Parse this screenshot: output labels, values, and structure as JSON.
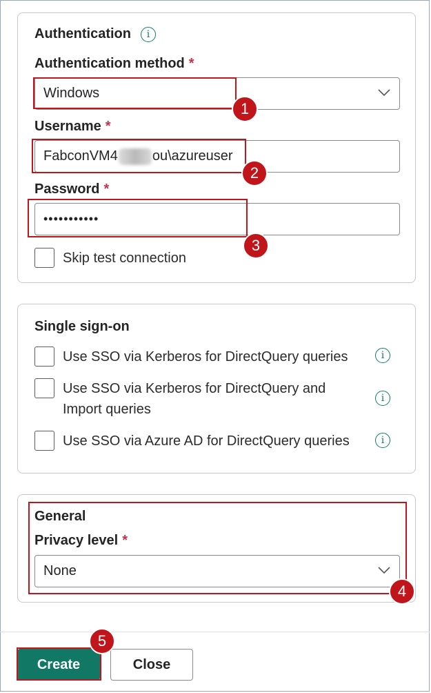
{
  "authentication": {
    "title": "Authentication",
    "method_label": "Authentication method",
    "method_value": "Windows",
    "username_label": "Username",
    "username_prefix": "FabconVM4",
    "username_suffix": "ou\\azureuser",
    "password_label": "Password",
    "password_value": "•••••••••••",
    "skip_test_label": "Skip test connection",
    "required_mark": "*"
  },
  "sso": {
    "title": "Single sign-on",
    "options": [
      {
        "label": "Use SSO via Kerberos for DirectQuery queries"
      },
      {
        "label": "Use SSO via Kerberos for DirectQuery and Import queries"
      },
      {
        "label": "Use SSO via Azure AD for DirectQuery queries"
      }
    ]
  },
  "general": {
    "title": "General",
    "privacy_label": "Privacy level",
    "privacy_value": "None"
  },
  "buttons": {
    "create": "Create",
    "close": "Close"
  },
  "callouts": [
    "1",
    "2",
    "3",
    "4",
    "5"
  ],
  "colors": {
    "accent": "#117865",
    "callout": "#c0151b",
    "required": "#c4314b",
    "info_icon": "#0f7c6a"
  },
  "icons": {
    "info": "info-icon",
    "dropdown": "chevron-down-icon"
  }
}
